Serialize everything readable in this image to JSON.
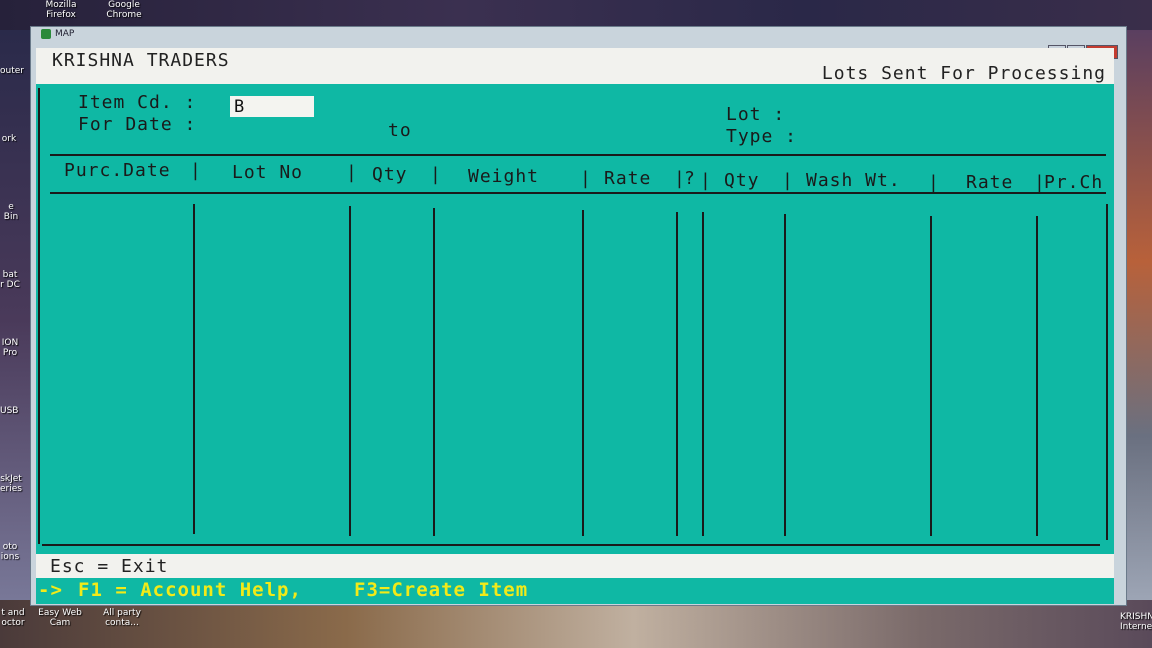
{
  "desktop": {
    "icons": [
      {
        "label": "Mozilla\nFirefox"
      },
      {
        "label": "Google\nChrome"
      },
      {
        "label": "outer"
      },
      {
        "label": "ork"
      },
      {
        "label": "e Bin"
      },
      {
        "label": "bat\nr DC"
      },
      {
        "label": "ION\nPro"
      },
      {
        "label": "USB"
      },
      {
        "label": "skJet\neries"
      },
      {
        "label": "oto\nions"
      },
      {
        "label": "t and\noctor"
      },
      {
        "label": "Easy Web\nCam"
      },
      {
        "label": "All party\nconta..."
      },
      {
        "label": "KRISHN\nInterne"
      }
    ]
  },
  "window": {
    "title": "MAP",
    "controls": {
      "minimize": "—",
      "maximize": "□",
      "close": "x"
    }
  },
  "header": {
    "company": "KRISHNA TRADERS",
    "screen_title": "Lots Sent For Processing"
  },
  "form": {
    "item_label": "Item Cd. :",
    "item_value": "B",
    "date_label": "For Date :",
    "to_label": "to",
    "lot_label": "Lot  :",
    "type_label": "Type :"
  },
  "table": {
    "columns": [
      "Purc.Date",
      "Lot No",
      "Qty",
      "Weight",
      "Rate",
      "?",
      "Qty",
      "Wash Wt.",
      "Rate",
      "Pr.Ch"
    ],
    "rows": []
  },
  "footer": {
    "esc": "Esc = Exit",
    "arrow": "->",
    "f1": "F1 = Account Help,",
    "f3": "F3=Create Item"
  }
}
